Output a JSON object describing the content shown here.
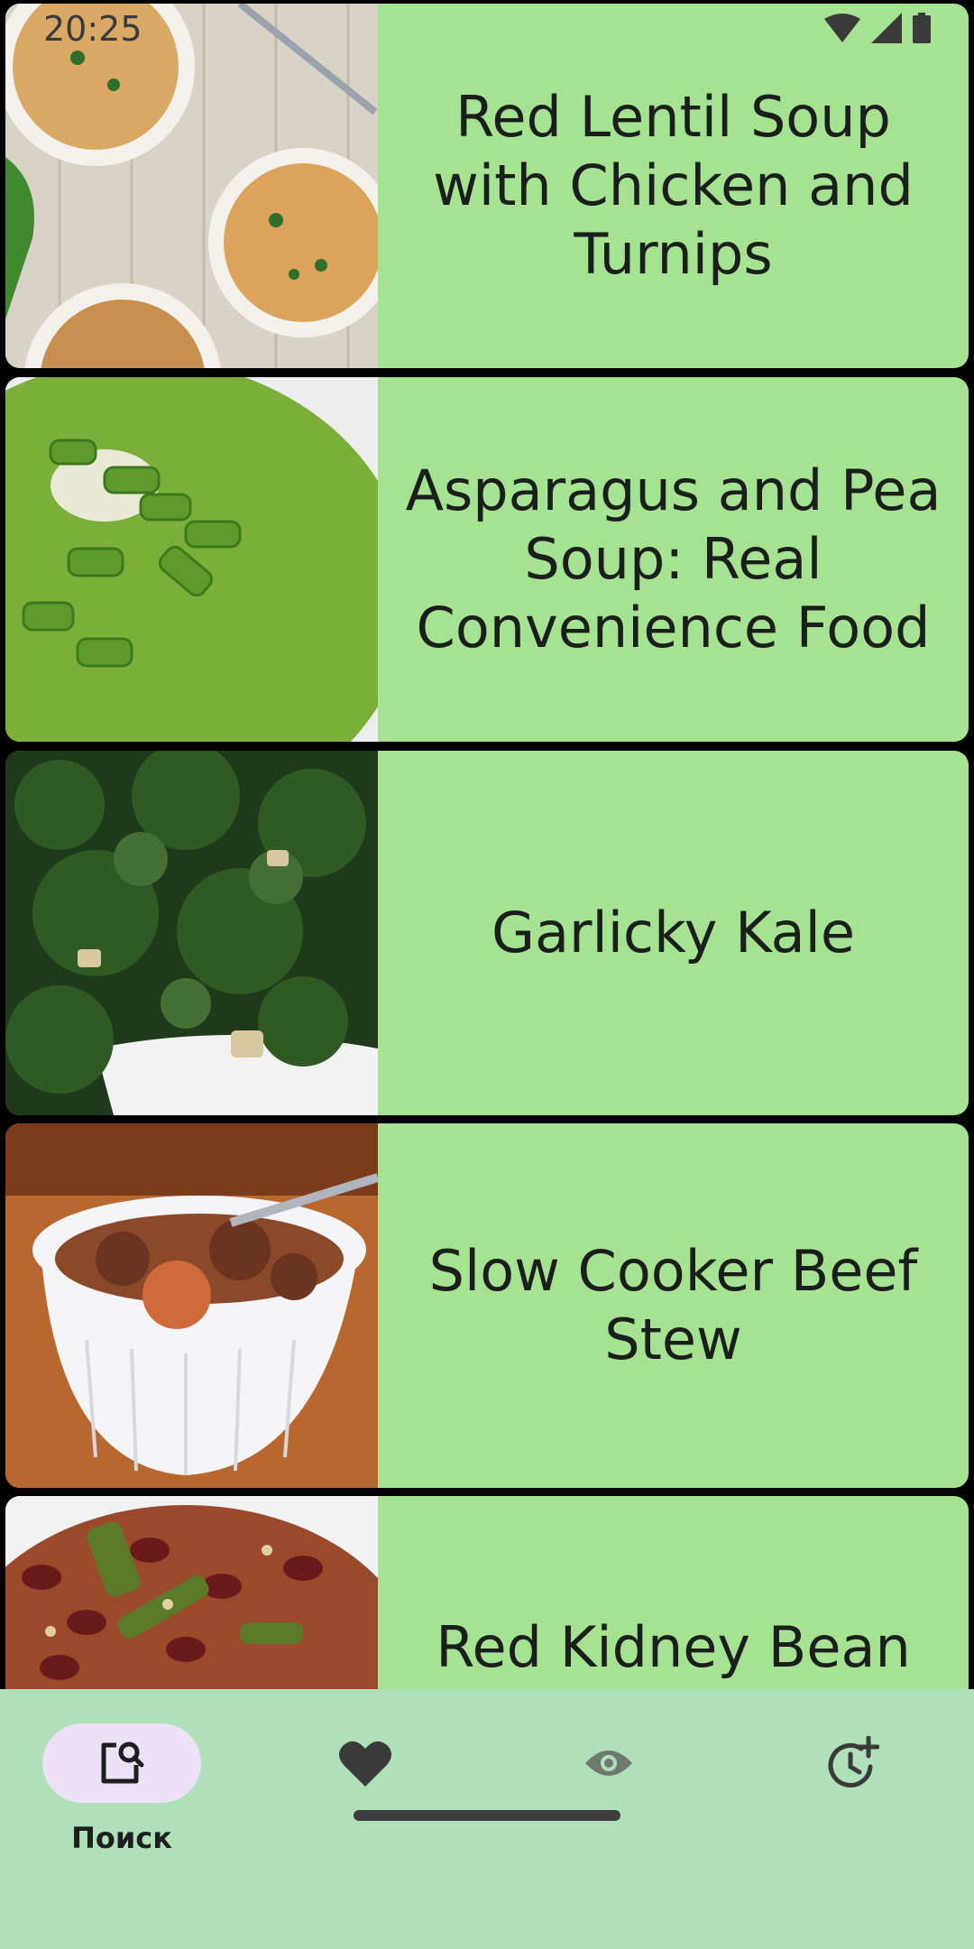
{
  "status_bar": {
    "time": "20:25"
  },
  "recipes": [
    {
      "title": "Red Lentil Soup with Chicken and Turnips",
      "image": "lentil-soup-bowls"
    },
    {
      "title": "Asparagus and Pea Soup: Real Convenience Food",
      "image": "green-pea-soup"
    },
    {
      "title": "Garlicky Kale",
      "image": "roasted-kale"
    },
    {
      "title": "Slow Cooker Beef Stew",
      "image": "beef-stew-bowl"
    },
    {
      "title": "Red Kidney Bean",
      "image": "red-bean-rice"
    }
  ],
  "bottom_nav": {
    "items": [
      {
        "icon": "search-document-icon",
        "label": "Поиск",
        "active": true
      },
      {
        "icon": "heart-icon",
        "label": "",
        "active": false
      },
      {
        "icon": "eye-icon",
        "label": "",
        "active": false
      },
      {
        "icon": "clock-plus-icon",
        "label": "",
        "active": false
      }
    ]
  },
  "colors": {
    "card_background": "#a5e393",
    "nav_background": "#b0e0b7",
    "active_pill": "#ece1f7",
    "text": "#1b1f1b"
  }
}
